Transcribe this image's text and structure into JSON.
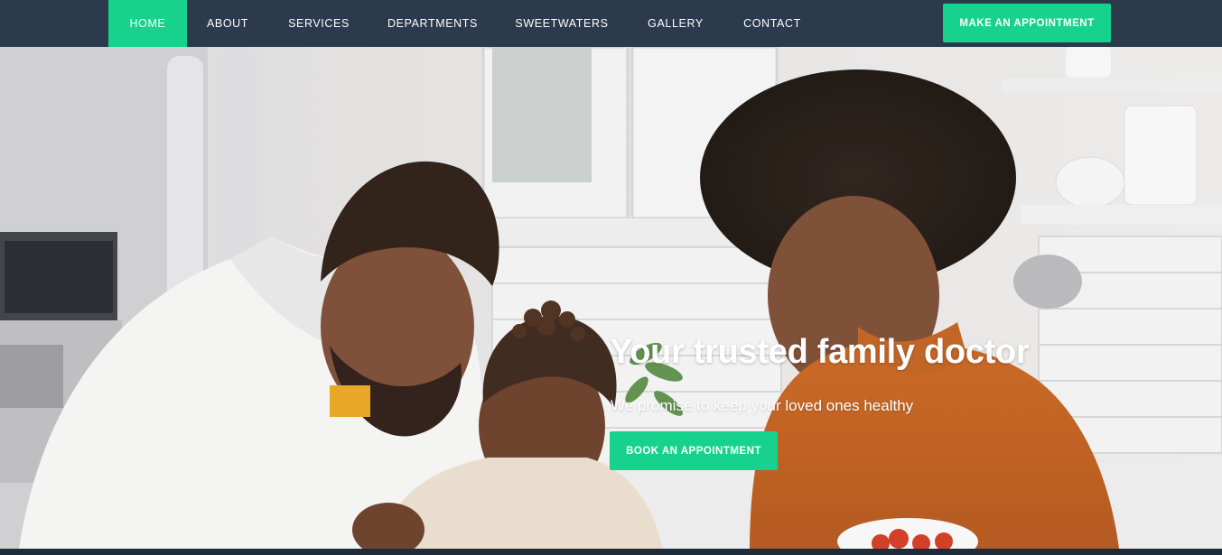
{
  "nav": {
    "items": [
      {
        "label": "HOME",
        "active": true
      },
      {
        "label": "ABOUT",
        "active": false
      },
      {
        "label": "SERVICES",
        "active": false
      },
      {
        "label": "DEPARTMENTS",
        "active": false
      },
      {
        "label": "SWEETWATERS",
        "active": false
      },
      {
        "label": "GALLERY",
        "active": false
      },
      {
        "label": "CONTACT",
        "active": false
      }
    ],
    "cta_label": "MAKE AN APPOINTMENT"
  },
  "hero": {
    "title": "Your trusted family doctor",
    "subtitle": "We promise to keep your loved ones healthy",
    "cta_label": "BOOK AN APPOINTMENT"
  },
  "colors": {
    "navbar_bg": "#2b3a4d",
    "accent": "#16d28c",
    "text_on_dark": "#ffffff"
  }
}
